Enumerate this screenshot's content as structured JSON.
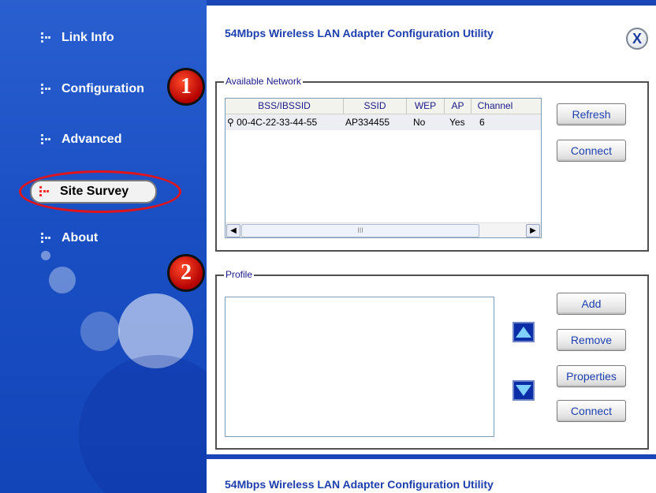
{
  "app": {
    "title": "54Mbps Wireless LAN Adapter Configuration Utility",
    "close_label": "X"
  },
  "sidebar": {
    "items": [
      {
        "label": "Link Info"
      },
      {
        "label": "Configuration"
      },
      {
        "label": "Advanced"
      },
      {
        "label": "Site Survey",
        "active": true
      },
      {
        "label": "About"
      }
    ]
  },
  "badges": {
    "one": "1",
    "two": "2"
  },
  "available_network": {
    "label": "Available Network",
    "columns": [
      "BSS/IBSSID",
      "SSID",
      "WEP",
      "AP",
      "Channel"
    ],
    "rows": [
      {
        "bssid": "00-4C-22-33-44-55",
        "ssid": "AP334455",
        "wep": "No",
        "ap": "Yes",
        "channel": "6"
      }
    ],
    "scroll_thumb_label": "III",
    "buttons": {
      "refresh": "Refresh",
      "connect": "Connect"
    }
  },
  "profile": {
    "label": "Profile",
    "buttons": {
      "add": "Add",
      "remove": "Remove",
      "properties": "Properties",
      "connect": "Connect"
    }
  },
  "bottom": {
    "title": "54Mbps Wireless LAN Adapter Configuration Utility"
  },
  "colors": {
    "sidebar": "#1a4fc4",
    "title": "#1d3fae",
    "badge": "#c40000",
    "highlight": "#e0141a"
  }
}
